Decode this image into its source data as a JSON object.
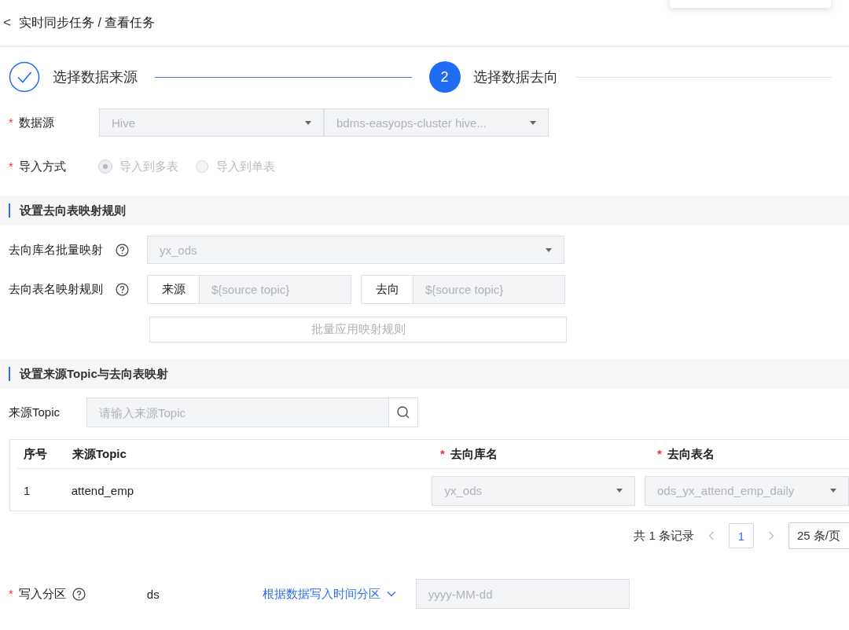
{
  "breadcrumb": {
    "back": "<",
    "path": "实时同步任务 / 查看任务"
  },
  "steps": [
    {
      "label": "选择数据来源",
      "kind": "done"
    },
    {
      "label": "选择数据去向",
      "kind": "current",
      "number": "2"
    }
  ],
  "datasource": {
    "label": "数据源",
    "required_mark": "*",
    "type": "Hive",
    "cluster": "bdms-easyops-cluster hive...",
    "disabled": true
  },
  "import_mode": {
    "label": "导入方式",
    "required_mark": "*",
    "options": [
      {
        "label": "导入到多表",
        "selected": true
      },
      {
        "label": "导入到单表",
        "selected": false
      }
    ],
    "disabled": true
  },
  "section_rules": {
    "title": "设置去向表映射规则"
  },
  "db_mapping": {
    "label": "去向库名批量映射",
    "value": "yx_ods"
  },
  "table_mapping": {
    "label": "去向表名映射规则",
    "source_addon": "来源",
    "source_value": "${source topic}",
    "target_addon": "去向",
    "target_value": "${source topic}"
  },
  "apply_button": "批量应用映射规则",
  "section_topic": {
    "title": "设置来源Topic与去向表映射"
  },
  "topic_search": {
    "label": "来源Topic",
    "placeholder": "请输入来源Topic"
  },
  "table": {
    "columns": [
      {
        "label": "序号"
      },
      {
        "label": "来源Topic"
      },
      {
        "label": "去向库名",
        "required_mark": "*"
      },
      {
        "label": "去向表名",
        "required_mark": "*"
      }
    ],
    "rows": [
      {
        "index": "1",
        "topic": "attend_emp",
        "db": "yx_ods",
        "table": "ods_yx_attend_emp_daily"
      }
    ]
  },
  "pagination": {
    "total": "共 1 条记录",
    "pages": [
      {
        "label": "1",
        "selected": true
      }
    ],
    "page_size": "25 条/页"
  },
  "partition": {
    "label": "写入分区",
    "required_mark": "*",
    "field": "ds",
    "mode": "根据数据写入时间分区",
    "placeholder": "yyyy-MM-dd"
  }
}
